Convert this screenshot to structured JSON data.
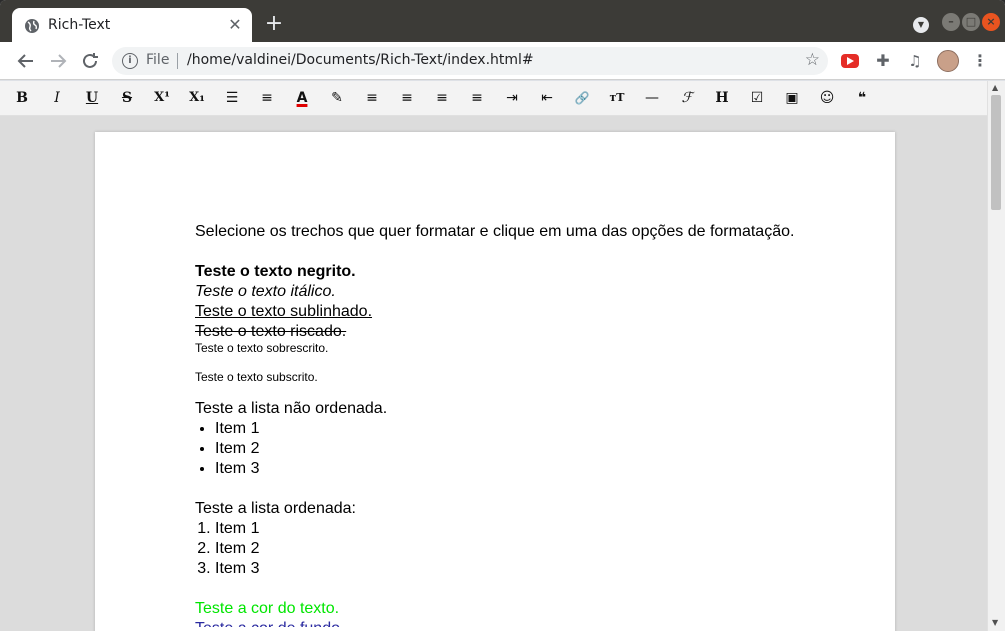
{
  "browser": {
    "tab_title": "Rich-Text",
    "tab_close": "✕",
    "new_tab": "+",
    "omnibox_scheme": "File",
    "url": "/home/valdinei/Documents/Rich-Text/index.html#"
  },
  "toolbar": {
    "bold": "B",
    "italic": "I",
    "underline": "U",
    "strike": "S",
    "superscript": "X¹",
    "subscript": "X₁",
    "unordered_list": "☰",
    "ordered_list": "≡",
    "text_color": "A",
    "highlight": "✎",
    "align_left": "≡",
    "align_center": "≡",
    "align_right": "≡",
    "justify": "≡",
    "indent": "⇥",
    "outdent": "⇤",
    "link": "🔗",
    "font_size": "тT",
    "horizontal_rule": "—",
    "font_family": "ℱ",
    "heading": "H",
    "checkbox": "☑",
    "image": "▣",
    "emoji": "☺",
    "quote": "❝"
  },
  "document": {
    "intro": "Selecione os trechos que quer formatar e clique em uma das opções de formatação.",
    "bold_text": "Teste o texto negrito.",
    "italic_text": "Teste o texto itálico.",
    "underline_text": "Teste o texto sublinhado.",
    "strike_text": "Teste o texto riscado.",
    "super_text": "Teste o texto sobrescrito.",
    "sub_text": "Teste o texto subscrito.",
    "ul_heading": "Teste a lista não ordenada.",
    "ul_items": [
      "Item 1",
      "Item 2",
      "Item 3"
    ],
    "ol_heading": "Teste a lista ordenada:",
    "ol_items": [
      "Item 1",
      "Item 2",
      "Item 3"
    ],
    "color_text": "Teste a cor do texto.",
    "bg_text": "Teste a cor de fundo.",
    "text_color_hex": "#00e600"
  }
}
